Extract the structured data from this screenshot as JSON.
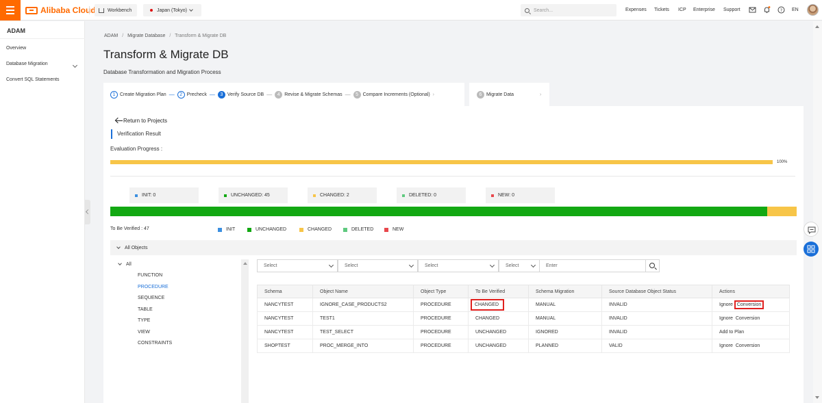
{
  "header": {
    "brand": "Alibaba Cloud",
    "workbench": "Workbench",
    "region": "Japan (Tokyo)",
    "search_placeholder": "Search...",
    "nav": [
      "Expenses",
      "Tickets",
      "ICP",
      "Enterprise",
      "Support"
    ],
    "lang": "EN"
  },
  "sidebar": {
    "title": "ADAM",
    "items": [
      {
        "label": "Overview"
      },
      {
        "label": "Database Migration"
      },
      {
        "label": "Convert SQL Statements"
      }
    ]
  },
  "breadcrumb": [
    "ADAM",
    "Migrate Database",
    "Transform & Migrate DB"
  ],
  "page": {
    "title": "Transform & Migrate DB",
    "subtitle": "Database Transformation and Migration Process"
  },
  "steps": [
    {
      "num": "1",
      "label": "Create Migration Plan",
      "state": "done"
    },
    {
      "num": "2",
      "label": "Precheck",
      "state": "done"
    },
    {
      "num": "3",
      "label": "Verify Source DB",
      "state": "current"
    },
    {
      "num": "4",
      "label": "Revise & Migrate Schemas",
      "state": "future"
    },
    {
      "num": "5",
      "label": "Compare Increments (Optional)",
      "state": "future"
    },
    {
      "num": "6",
      "label": "Migrate Data",
      "state": "future"
    }
  ],
  "verification": {
    "return_label": "Return to Projects",
    "section_title": "Verification Result",
    "progress_label": "Evaluation Progress :",
    "progress_value": 100,
    "progress_text": "100%"
  },
  "stats": [
    {
      "label": "INIT: 0",
      "color": "#3b8fe0"
    },
    {
      "label": "UNCHANGED: 45",
      "color": "#12a812"
    },
    {
      "label": "CHANGED: 2",
      "color": "#f7c548"
    },
    {
      "label": "DELETED: 0",
      "color": "#5fc97f"
    },
    {
      "label": "NEW: 0",
      "color": "#e8474c"
    }
  ],
  "distribution": [
    {
      "name": "UNCHANGED",
      "count": 45,
      "color": "#12a812"
    },
    {
      "name": "CHANGED",
      "count": 2,
      "color": "#f7c548"
    }
  ],
  "to_be_verified": "To Be Verified : 47",
  "legend": [
    {
      "label": "INIT",
      "color": "#3b8fe0"
    },
    {
      "label": "UNCHANGED",
      "color": "#12a812"
    },
    {
      "label": "CHANGED",
      "color": "#f7c548"
    },
    {
      "label": "DELETED",
      "color": "#5fc97f"
    },
    {
      "label": "NEW",
      "color": "#e8474c"
    }
  ],
  "objects_header": "All Objects",
  "tree": {
    "root": "All",
    "children": [
      "FUNCTION",
      "PROCEDURE",
      "SEQUENCE",
      "TABLE",
      "TYPE",
      "VIEW",
      "CONSTRAINTS"
    ],
    "selected": "PROCEDURE"
  },
  "filters": {
    "selects": [
      "Select",
      "Select",
      "Select",
      "Select"
    ],
    "input_placeholder": "Enter"
  },
  "table": {
    "columns": [
      "Schema",
      "Object Name",
      "Object Type",
      "To Be Verified",
      "Schema Migration",
      "Source Database Object Status",
      "Actions"
    ],
    "rows": [
      {
        "schema": "NANCYTEST",
        "name": "IGNORE_CASE_PRODUCTS2",
        "type": "PROCEDURE",
        "verified": "CHANGED",
        "migration": "MANUAL",
        "status": "INVALID",
        "actions": [
          "Ignore",
          "Conversion"
        ]
      },
      {
        "schema": "NANCYTEST",
        "name": "TEST1",
        "type": "PROCEDURE",
        "verified": "CHANGED",
        "migration": "MANUAL",
        "status": "INVALID",
        "actions": [
          "Ignore",
          "Conversion"
        ]
      },
      {
        "schema": "NANCYTEST",
        "name": "TEST_SELECT",
        "type": "PROCEDURE",
        "verified": "UNCHANGED",
        "migration": "IGNORED",
        "status": "INVALID",
        "actions": [
          "Add to Plan"
        ]
      },
      {
        "schema": "SHOPTEST",
        "name": "PROC_MERGE_INTO",
        "type": "PROCEDURE",
        "verified": "UNCHANGED",
        "migration": "PLANNED",
        "status": "VALID",
        "actions": [
          "Ignore",
          "Conversion"
        ]
      }
    ]
  },
  "colors": {
    "accent": "#ff6a00",
    "primary": "#1a6fd8",
    "highlight": "#e0201e"
  }
}
